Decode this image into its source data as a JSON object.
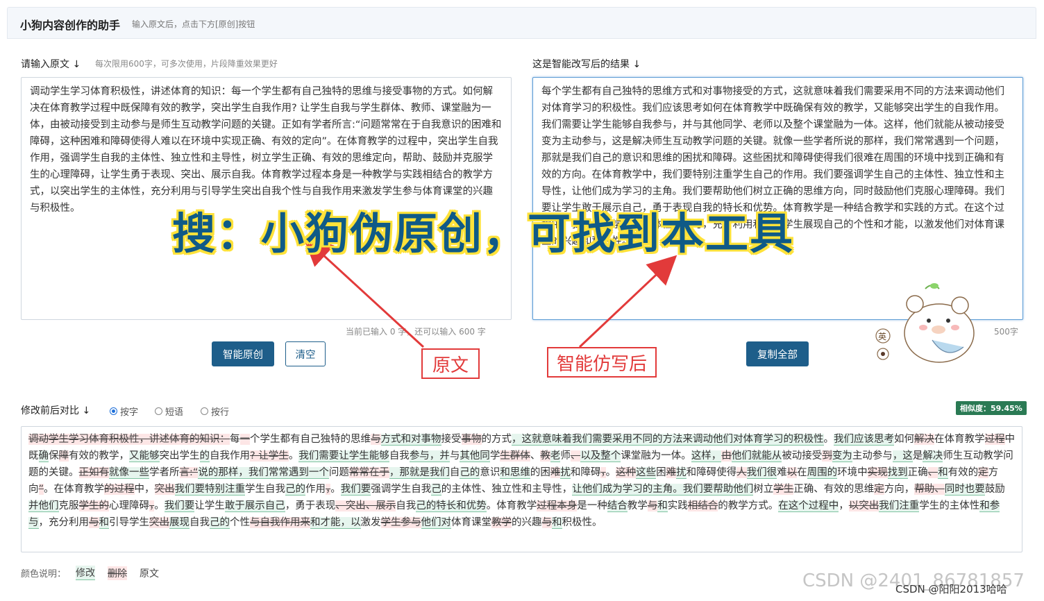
{
  "header": {
    "title": "小狗内容创作的助手",
    "subtitle": "输入原文后，点击下方[原创]按钮"
  },
  "input": {
    "label": "请输入原文 ↓",
    "hint": "每次限用600字，可多次使用，片段降重效果更好",
    "text": "调动学生学习体育积极性，讲述体育的知识：每一个学生都有自己独特的思维与接受事物的方式。如何解决在体育教学过程中既保障有效的教学，突出学生自我作用? 让学生自我与学生群体、教师、课堂融为一体，由被动接受到主动参与是师生互动教学问题的关键。正如有学者所言:“问题常常在于自我意识的困难和障碍，这种困难和障碍使得人难以在环境中实现正确、有效的定向”。在体育教学的过程中，突出学生自我作用，强调学生自我的主体性、独立性和主导性，树立学生正确、有效的思维定向，帮助、鼓励并克服学生的心理障碍，让学生勇于表现、突出、展示自我。体育教学过程本身是一种教学与实践相结合的教学方式，以突出学生的主体性，充分利用与引导学生突出自我个性与自我作用来激发学生参与体育课堂的兴趣与积极性。",
    "counter": "当前已输入 0 字，还可以输入 600 字"
  },
  "output": {
    "label": "这是智能改写后的结果 ↓",
    "text": "每个学生都有自己独特的思维方式和对事物接受的方式，这就意味着我们需要采用不同的方法来调动他们对体育学习的积极性。我们应该思考如何在体育教学中既确保有效的教学，又能够突出学生的自我作用。我们需要让学生能够自我参与，并与其他同学、老师以及整个课堂融为一体。这样，他们就能从被动接受变为主动参与，这是解决师生互动教学问题的关键。就像一些学者所说的那样，我们常常遇到一个问题，那就是我们自己的意识和思维的困扰和障碍。这些困扰和障碍使得我们很难在周围的环境中找到正确和有效的方向。在体育教学中，我们要特别注重学生自己的作用。我们要强调学生自己的主体性、独立性和主导性，让他们成为学习的主角。我们要帮助他们树立正确的思维方向，同时鼓励他们克服心理障碍。我们要让学生敢于展示自己，勇于表现自我的特长和优势。体育教学是一种结合教学和实践的方式。在这个过程中，我们注重学生的主体性和参与，充分利用和引导学生展现自己的个性和才能，以激发他们对体育课堂的兴趣和积极性。",
    "counter": "500字"
  },
  "buttons": {
    "rewrite": "智能原创",
    "clear": "清空",
    "copy_all": "复制全部"
  },
  "compare": {
    "label": "修改前后对比 ↓",
    "options": [
      "按字",
      "短语",
      "按行"
    ],
    "selected": "按字",
    "similarity": "相似度：59.45%",
    "legend_title": "颜色说明：",
    "legend_modify": "修改",
    "legend_delete": "删除",
    "legend_original": "原文"
  },
  "diff": [
    {
      "t": "d",
      "s": "调动学生学习体育积极性，讲述体育的知识："
    },
    {
      "t": "o",
      "s": "每"
    },
    {
      "t": "d",
      "s": "一"
    },
    {
      "t": "o",
      "s": "个学生都有自己独特的思维"
    },
    {
      "t": "d",
      "s": "与"
    },
    {
      "t": "i",
      "s": "方式和对事物"
    },
    {
      "t": "o",
      "s": "接受"
    },
    {
      "t": "d",
      "s": "事物"
    },
    {
      "t": "o",
      "s": "的方式"
    },
    {
      "t": "i",
      "s": "，这就意味着我们需要采用不同的方法来调动他们对体育学习的积极性"
    },
    {
      "t": "o",
      "s": "。"
    },
    {
      "t": "i",
      "s": "我们应该思考"
    },
    {
      "t": "o",
      "s": "如何"
    },
    {
      "t": "d",
      "s": "解决"
    },
    {
      "t": "o",
      "s": "在体育教学"
    },
    {
      "t": "d",
      "s": "过程"
    },
    {
      "t": "o",
      "s": "中既"
    },
    {
      "t": "i",
      "s": "确"
    },
    {
      "t": "o",
      "s": "保"
    },
    {
      "t": "d",
      "s": "障"
    },
    {
      "t": "o",
      "s": "有效的教学，"
    },
    {
      "t": "i",
      "s": "又能够"
    },
    {
      "t": "o",
      "s": "突出学生"
    },
    {
      "t": "i",
      "s": "的"
    },
    {
      "t": "o",
      "s": "自我作用"
    },
    {
      "t": "d",
      "s": "? 让学生"
    },
    {
      "t": "o",
      "s": "。"
    },
    {
      "t": "i",
      "s": "我们需要让学生能够"
    },
    {
      "t": "o",
      "s": "自我"
    },
    {
      "t": "i",
      "s": "参与，并"
    },
    {
      "t": "o",
      "s": "与"
    },
    {
      "t": "i",
      "s": "其他同"
    },
    {
      "t": "o",
      "s": "学"
    },
    {
      "t": "d",
      "s": "生群体"
    },
    {
      "t": "o",
      "s": "、"
    },
    {
      "t": "d",
      "s": "教"
    },
    {
      "t": "i",
      "s": "老"
    },
    {
      "t": "o",
      "s": "师"
    },
    {
      "t": "d",
      "s": "、"
    },
    {
      "t": "i",
      "s": "以及整个"
    },
    {
      "t": "o",
      "s": "课堂融为一体。"
    },
    {
      "t": "i",
      "s": "这样，"
    },
    {
      "t": "d",
      "s": "由"
    },
    {
      "t": "i",
      "s": "他们就能从"
    },
    {
      "t": "o",
      "s": "被动接受"
    },
    {
      "t": "d",
      "s": "到"
    },
    {
      "t": "i",
      "s": "变为"
    },
    {
      "t": "o",
      "s": "主动参与"
    },
    {
      "t": "i",
      "s": "，这"
    },
    {
      "t": "o",
      "s": "是"
    },
    {
      "t": "i",
      "s": "解决"
    },
    {
      "t": "o",
      "s": "师生互动教学问题的关键。"
    },
    {
      "t": "d",
      "s": "正如有"
    },
    {
      "t": "i",
      "s": "就像一些"
    },
    {
      "t": "o",
      "s": "学者所"
    },
    {
      "t": "d",
      "s": "言:“"
    },
    {
      "t": "i",
      "s": "说的那样，我们常常遇到一个"
    },
    {
      "t": "o",
      "s": "问题"
    },
    {
      "t": "d",
      "s": "常常在于"
    },
    {
      "t": "i",
      "s": "，那就是我们"
    },
    {
      "t": "o",
      "s": "自"
    },
    {
      "t": "i",
      "s": "己的"
    },
    {
      "t": "o",
      "s": "意识"
    },
    {
      "t": "i",
      "s": "和思维"
    },
    {
      "t": "o",
      "s": "的困"
    },
    {
      "t": "d",
      "s": "难"
    },
    {
      "t": "i",
      "s": "扰"
    },
    {
      "t": "o",
      "s": "和障碍"
    },
    {
      "t": "d",
      "s": "，"
    },
    {
      "t": "o",
      "s": "。"
    },
    {
      "t": "d",
      "s": "这种"
    },
    {
      "t": "i",
      "s": "这些"
    },
    {
      "t": "o",
      "s": "困"
    },
    {
      "t": "d",
      "s": "难"
    },
    {
      "t": "i",
      "s": "扰"
    },
    {
      "t": "o",
      "s": "和障碍使得"
    },
    {
      "t": "d",
      "s": "人"
    },
    {
      "t": "i",
      "s": "我们很"
    },
    {
      "t": "o",
      "s": "难"
    },
    {
      "t": "d",
      "s": "以"
    },
    {
      "t": "o",
      "s": "在"
    },
    {
      "t": "i",
      "s": "周围的"
    },
    {
      "t": "o",
      "s": "环境中"
    },
    {
      "t": "d",
      "s": "实现"
    },
    {
      "t": "i",
      "s": "找到"
    },
    {
      "t": "o",
      "s": "正确"
    },
    {
      "t": "d",
      "s": "、"
    },
    {
      "t": "i",
      "s": "和"
    },
    {
      "t": "o",
      "s": "有效的"
    },
    {
      "t": "d",
      "s": "定"
    },
    {
      "t": "o",
      "s": "方向"
    },
    {
      "t": "d",
      "s": "”"
    },
    {
      "t": "o",
      "s": "。在体育教学"
    },
    {
      "t": "d",
      "s": "的过程"
    },
    {
      "t": "o",
      "s": "中，"
    },
    {
      "t": "d",
      "s": "突出"
    },
    {
      "t": "i",
      "s": "我们要特别注重"
    },
    {
      "t": "o",
      "s": "学生自我"
    },
    {
      "t": "i",
      "s": "己的"
    },
    {
      "t": "o",
      "s": "作用"
    },
    {
      "t": "d",
      "s": "，"
    },
    {
      "t": "o",
      "s": "。"
    },
    {
      "t": "i",
      "s": "我们要"
    },
    {
      "t": "o",
      "s": "强调学生自我"
    },
    {
      "t": "i",
      "s": "己"
    },
    {
      "t": "o",
      "s": "的主体性、独立性和主导性，"
    },
    {
      "t": "i",
      "s": "让他们成为学习的主角。我们要帮助他们"
    },
    {
      "t": "o",
      "s": "树立"
    },
    {
      "t": "d",
      "s": "学生"
    },
    {
      "t": "o",
      "s": "正确、有效的思维"
    },
    {
      "t": "d",
      "s": "定"
    },
    {
      "t": "o",
      "s": "方向，"
    },
    {
      "t": "d",
      "s": "帮助、"
    },
    {
      "t": "i",
      "s": "同时也要"
    },
    {
      "t": "o",
      "s": "鼓励"
    },
    {
      "t": "i",
      "s": "并他们"
    },
    {
      "t": "o",
      "s": "克服"
    },
    {
      "t": "d",
      "s": "学生的"
    },
    {
      "t": "o",
      "s": "心理障碍"
    },
    {
      "t": "d",
      "s": "，"
    },
    {
      "t": "o",
      "s": "。"
    },
    {
      "t": "i",
      "s": "我们要"
    },
    {
      "t": "o",
      "s": "让学生"
    },
    {
      "t": "i",
      "s": "敢于展示自己"
    },
    {
      "t": "o",
      "s": "，勇于表现"
    },
    {
      "t": "d",
      "s": "、突出、展示"
    },
    {
      "t": "o",
      "s": "自我"
    },
    {
      "t": "i",
      "s": "己的特长和优势"
    },
    {
      "t": "o",
      "s": "。体育教学"
    },
    {
      "t": "d",
      "s": "过程本身"
    },
    {
      "t": "o",
      "s": "是一种"
    },
    {
      "t": "i",
      "s": "结合"
    },
    {
      "t": "o",
      "s": "教学"
    },
    {
      "t": "d",
      "s": "与"
    },
    {
      "t": "i",
      "s": "和"
    },
    {
      "t": "o",
      "s": "实践"
    },
    {
      "t": "d",
      "s": "相结合"
    },
    {
      "t": "o",
      "s": "的教学方式。"
    },
    {
      "t": "i",
      "s": "在这个过程中"
    },
    {
      "t": "o",
      "s": "，"
    },
    {
      "t": "d",
      "s": "以突出"
    },
    {
      "t": "i",
      "s": "我们注重"
    },
    {
      "t": "o",
      "s": "学生的主体性"
    },
    {
      "t": "i",
      "s": "和参与"
    },
    {
      "t": "o",
      "s": "，充分利用"
    },
    {
      "t": "d",
      "s": "与"
    },
    {
      "t": "i",
      "s": "和"
    },
    {
      "t": "o",
      "s": "引导学生"
    },
    {
      "t": "d",
      "s": "突出"
    },
    {
      "t": "i",
      "s": "展现"
    },
    {
      "t": "o",
      "s": "自我"
    },
    {
      "t": "i",
      "s": "己的"
    },
    {
      "t": "o",
      "s": "个性"
    },
    {
      "t": "d",
      "s": "与自我作用来"
    },
    {
      "t": "i",
      "s": "和才能，以"
    },
    {
      "t": "o",
      "s": "激发"
    },
    {
      "t": "d",
      "s": "学生参与"
    },
    {
      "t": "i",
      "s": "他们对"
    },
    {
      "t": "o",
      "s": "体育课堂"
    },
    {
      "t": "d",
      "s": "教学"
    },
    {
      "t": "o",
      "s": "的兴趣"
    },
    {
      "t": "d",
      "s": "与"
    },
    {
      "t": "i",
      "s": "和"
    },
    {
      "t": "o",
      "s": "积极性。"
    }
  ],
  "annotations": {
    "overlay": "搜：小狗伪原创，可找到本工具",
    "callout_original": "原文",
    "callout_rewritten": "智能仿写后",
    "mascot_badge": "英"
  },
  "watermark": {
    "text": "CSDN @2401_86781857",
    "author": "CSDN @阳阳2013哈哈"
  },
  "colors": {
    "primary": "#1e5e8a",
    "accent_red": "#e23a3a",
    "overlay_text": "#0f5a87",
    "overlay_outline": "#ffe23a",
    "similarity_badge": "#2a7a54"
  }
}
